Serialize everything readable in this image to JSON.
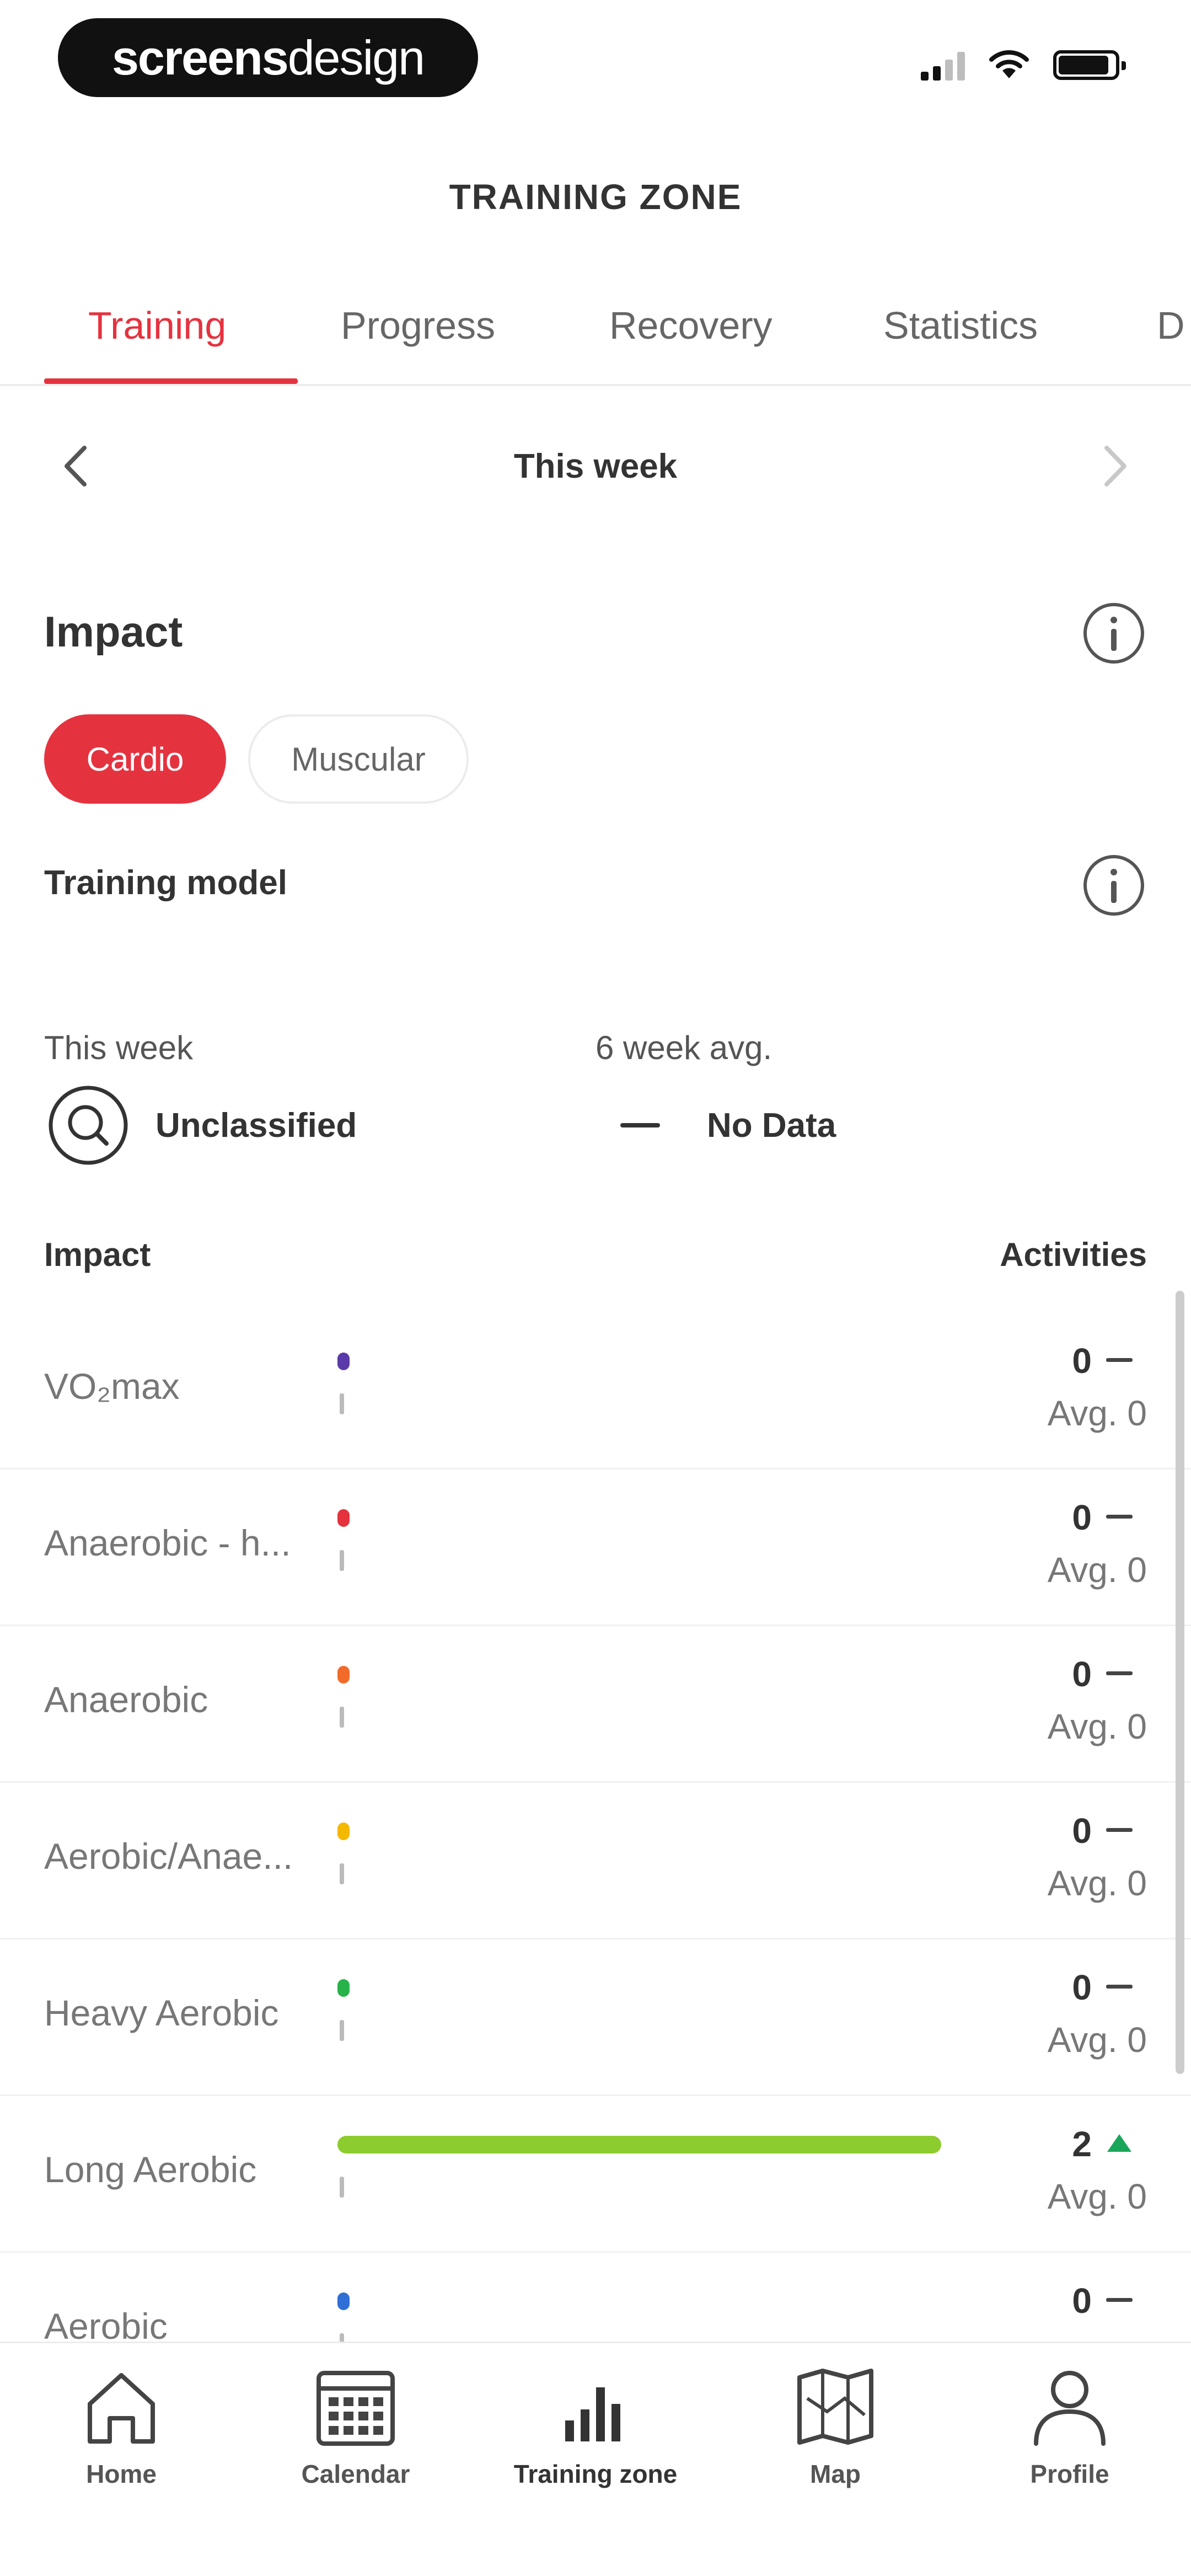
{
  "status_bar": {
    "logo_bold": "screens",
    "logo_light": "design"
  },
  "header": {
    "title": "TRAINING ZONE"
  },
  "tabs": [
    {
      "label": "Training",
      "active": true
    },
    {
      "label": "Progress",
      "active": false
    },
    {
      "label": "Recovery",
      "active": false
    },
    {
      "label": "Statistics",
      "active": false
    },
    {
      "label": "D",
      "active": false
    }
  ],
  "week_nav": {
    "label": "This week",
    "prev_icon": "chevron-left-icon",
    "next_icon": "chevron-right-icon"
  },
  "impact": {
    "title": "Impact",
    "toggle": {
      "cardio": "Cardio",
      "muscular": "Muscular",
      "selected": "cardio"
    },
    "training_model": {
      "title": "Training model",
      "this_week_label": "This week",
      "this_week_value": "Unclassified",
      "six_week_label": "6 week avg.",
      "six_week_value": "No Data"
    },
    "columns": {
      "impact": "Impact",
      "activities": "Activities"
    },
    "zones": [
      {
        "name": "VO₂max",
        "color": "#5a3aa8",
        "count": "0",
        "trend": "dash",
        "avg": "Avg. 0",
        "fill": 0
      },
      {
        "name": "Anaerobic - h...",
        "color": "#e5323f",
        "count": "0",
        "trend": "dash",
        "avg": "Avg. 0",
        "fill": 0
      },
      {
        "name": "Anaerobic",
        "color": "#f26b2a",
        "count": "0",
        "trend": "dash",
        "avg": "Avg. 0",
        "fill": 0
      },
      {
        "name": "Aerobic/Anae...",
        "color": "#f5b800",
        "count": "0",
        "trend": "dash",
        "avg": "Avg. 0",
        "fill": 0
      },
      {
        "name": "Heavy Aerobic",
        "color": "#28b34a",
        "count": "0",
        "trend": "dash",
        "avg": "Avg. 0",
        "fill": 0
      },
      {
        "name": "Long Aerobic",
        "color": "#8ccc2e",
        "count": "2",
        "trend": "up",
        "avg": "Avg. 0",
        "fill": 1
      },
      {
        "name": "Aerobic",
        "color": "#2f6fd6",
        "count": "0",
        "trend": "dash",
        "avg": "",
        "fill": 0
      }
    ]
  },
  "bottom_nav": [
    {
      "label": "Home",
      "icon": "home-icon"
    },
    {
      "label": "Calendar",
      "icon": "calendar-icon"
    },
    {
      "label": "Training zone",
      "icon": "bar-chart-icon",
      "active": true
    },
    {
      "label": "Map",
      "icon": "map-icon"
    },
    {
      "label": "Profile",
      "icon": "profile-icon"
    }
  ],
  "colors": {
    "accent": "#e5323f",
    "trend_up": "#1aa65a"
  }
}
